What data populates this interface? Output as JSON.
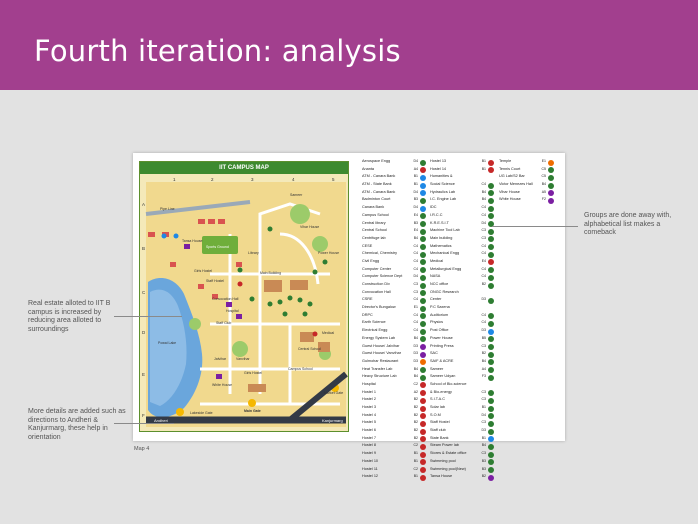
{
  "slide": {
    "title": "Fourth iteration: analysis",
    "accent": "#a23f8e"
  },
  "map": {
    "title": "IIT CAMPUS MAP",
    "col_labels": [
      "1",
      "2",
      "3",
      "4",
      "5"
    ],
    "row_labels": [
      "A",
      "B",
      "C",
      "D",
      "E",
      "F"
    ],
    "place_labels": [
      "Pipe Line",
      "Tansa House",
      "Sports Ground",
      "Library",
      "Sameer",
      "Vihar House",
      "Power House",
      "Girls Hostel",
      "Staff Hostel",
      "Convocation Hall",
      "Hospital",
      "Main Building",
      "Staff Club",
      "Powai Lake",
      "Jalvihar",
      "Vanvihar",
      "Girls Hostel",
      "Central School",
      "Campus School",
      "Medical",
      "White House",
      "Main Gate",
      "Market Gate",
      "Lakeside Gate",
      "Andheri",
      "Kanjurmarg"
    ]
  },
  "caption": "Map 4",
  "lists": {
    "col1": [
      {
        "name": "Aerospace Engg",
        "code": "D4",
        "color": "#2e7d32"
      },
      {
        "name": "Ananta",
        "code": "A4",
        "color": "#c62828"
      },
      {
        "name": "ATM - Canara Bank",
        "code": "B1",
        "color": "#1e88e5"
      },
      {
        "name": "ATM - State Bank",
        "code": "B1",
        "color": "#1e88e5"
      },
      {
        "name": "ATM - Canara Bank",
        "code": "D4",
        "color": "#1e88e5"
      },
      {
        "name": "Badminton Court",
        "code": "B3",
        "color": "#2e7d32"
      },
      {
        "name": "Canara Bank",
        "code": "D4",
        "color": "#1e88e5"
      },
      {
        "name": "Campus School",
        "code": "E4",
        "color": "#2e7d32"
      },
      {
        "name": "Central library",
        "code": "B3",
        "color": "#2e7d32"
      },
      {
        "name": "Central School",
        "code": "E4",
        "color": "#2e7d32"
      },
      {
        "name": "Centrifuge lab",
        "code": "B4",
        "color": "#2e7d32"
      },
      {
        "name": "CESE",
        "code": "C4",
        "color": "#2e7d32"
      },
      {
        "name": "Chemical, Chemistry",
        "code": "C4",
        "color": "#2e7d32"
      },
      {
        "name": "Civil Engg",
        "code": "C4",
        "color": "#2e7d32"
      },
      {
        "name": "Computer Center",
        "code": "C4",
        "color": "#2e7d32"
      },
      {
        "name": "Computer Science Dept",
        "code": "D4",
        "color": "#2e7d32"
      },
      {
        "name": "Construction Div",
        "code": "C3",
        "color": "#2e7d32"
      },
      {
        "name": "Convocation Hall",
        "code": "C3",
        "color": "#2e7d32"
      },
      {
        "name": "CSRE",
        "code": "C4",
        "color": "#2e7d32"
      },
      {
        "name": "Director's Bungalow",
        "code": "E1",
        "color": "#2e7d32"
      },
      {
        "name": "DRPC",
        "code": "C4",
        "color": "#2e7d32"
      },
      {
        "name": "Earth Science",
        "code": "C4",
        "color": "#2e7d32"
      },
      {
        "name": "Electrical Engg",
        "code": "C4",
        "color": "#2e7d32"
      },
      {
        "name": "Energy System Lab",
        "code": "B4",
        "color": "#2e7d32"
      },
      {
        "name": "Guest House/ Jalvihar",
        "code": "D3",
        "color": "#7b1fa2"
      },
      {
        "name": "Guest House/ Vanvihar",
        "code": "D3",
        "color": "#7b1fa2"
      },
      {
        "name": "Gulmohar Restaurant",
        "code": "D3",
        "color": "#ef6c00"
      },
      {
        "name": "Heat Transfer Lab",
        "code": "B4",
        "color": "#2e7d32"
      },
      {
        "name": "Heavy Structure Lab",
        "code": "B4",
        "color": "#2e7d32"
      },
      {
        "name": "Hospital",
        "code": "C2",
        "color": "#c62828"
      },
      {
        "name": "Hostel 1",
        "code": "A2",
        "color": "#c62828"
      },
      {
        "name": "Hostel 2",
        "code": "B2",
        "color": "#c62828"
      },
      {
        "name": "Hostel 3",
        "code": "B2",
        "color": "#c62828"
      },
      {
        "name": "Hostel 4",
        "code": "B2",
        "color": "#c62828"
      },
      {
        "name": "Hostel 5",
        "code": "B2",
        "color": "#c62828"
      },
      {
        "name": "Hostel 6",
        "code": "B2",
        "color": "#c62828"
      },
      {
        "name": "Hostel 7",
        "code": "B2",
        "color": "#c62828"
      },
      {
        "name": "Hostel 8",
        "code": "C2",
        "color": "#c62828"
      },
      {
        "name": "Hostel 9",
        "code": "B1",
        "color": "#c62828"
      },
      {
        "name": "Hostel 10",
        "code": "B1",
        "color": "#c62828"
      },
      {
        "name": "Hostel 11",
        "code": "C2",
        "color": "#c62828"
      },
      {
        "name": "Hostel 12",
        "code": "B1",
        "color": "#c62828"
      }
    ],
    "col2": [
      {
        "name": "Hostel 13",
        "code": "B1",
        "color": "#c62828"
      },
      {
        "name": "Hostel 14",
        "code": "B1",
        "color": "#c62828"
      },
      {
        "name": "Humanities &",
        "code": "",
        "color": ""
      },
      {
        "name": "Social Science",
        "code": "C4",
        "color": "#2e7d32"
      },
      {
        "name": "Hydraulics Lab",
        "code": "B4",
        "color": "#2e7d32"
      },
      {
        "name": "I.C. Engine Lab",
        "code": "B4",
        "color": "#2e7d32"
      },
      {
        "name": "IDC",
        "code": "C4",
        "color": "#2e7d32"
      },
      {
        "name": "I.R.C.C",
        "code": "C4",
        "color": "#2e7d32"
      },
      {
        "name": "K.R.E.S.I.T",
        "code": "D4",
        "color": "#2e7d32"
      },
      {
        "name": "Machine Tool Lab",
        "code": "C3",
        "color": "#2e7d32"
      },
      {
        "name": "Main building",
        "code": "C3",
        "color": "#2e7d32"
      },
      {
        "name": "Mathematics",
        "code": "C4",
        "color": "#2e7d32"
      },
      {
        "name": "Mechanical Engg",
        "code": "C4",
        "color": "#2e7d32"
      },
      {
        "name": "Medical",
        "code": "E4",
        "color": "#c62828"
      },
      {
        "name": "Metallurgical Engg",
        "code": "C4",
        "color": "#2e7d32"
      },
      {
        "name": "NASA",
        "code": "C4",
        "color": "#2e7d32"
      },
      {
        "name": "NCC office",
        "code": "B2",
        "color": "#2e7d32"
      },
      {
        "name": "ONGC Research",
        "code": "",
        "color": ""
      },
      {
        "name": "Center",
        "code": "D3",
        "color": "#2e7d32"
      },
      {
        "name": "P.C Saxena",
        "code": "",
        "color": ""
      },
      {
        "name": "Auditorium",
        "code": "C4",
        "color": "#2e7d32"
      },
      {
        "name": "Physics",
        "code": "C4",
        "color": "#2e7d32"
      },
      {
        "name": "Post Office",
        "code": "D3",
        "color": "#1e88e5"
      },
      {
        "name": "Power House",
        "code": "B5",
        "color": "#2e7d32"
      },
      {
        "name": "Printing Press",
        "code": "C3",
        "color": "#2e7d32"
      },
      {
        "name": "SAC",
        "code": "B2",
        "color": "#2e7d32"
      },
      {
        "name": "SAIF & ACRE",
        "code": "B4",
        "color": "#2e7d32"
      },
      {
        "name": "Sameer",
        "code": "A4",
        "color": "#2e7d32"
      },
      {
        "name": "Sameer Udyan",
        "code": "F3",
        "color": "#2e7d32"
      },
      {
        "name": "School of Bio-science",
        "code": "",
        "color": ""
      },
      {
        "name": "& Bio-energy",
        "code": "C3",
        "color": "#2e7d32"
      },
      {
        "name": "S.I.T.A.C",
        "code": "C3",
        "color": "#2e7d32"
      },
      {
        "name": "Solar lab",
        "code": "B1",
        "color": "#2e7d32"
      },
      {
        "name": "S.O.M",
        "code": "D4",
        "color": "#2e7d32"
      },
      {
        "name": "Staff Hostel",
        "code": "C3",
        "color": "#2e7d32"
      },
      {
        "name": "Staff club",
        "code": "D3",
        "color": "#2e7d32"
      },
      {
        "name": "State Bank",
        "code": "B1",
        "color": "#1e88e5"
      },
      {
        "name": "Steam Power lab",
        "code": "B4",
        "color": "#2e7d32"
      },
      {
        "name": "Stores & Estate office",
        "code": "C3",
        "color": "#2e7d32"
      },
      {
        "name": "Swimming pool",
        "code": "B3",
        "color": "#2e7d32"
      },
      {
        "name": "Swimming pool(New)",
        "code": "B3",
        "color": "#2e7d32"
      },
      {
        "name": "Tansa House",
        "code": "B2",
        "color": "#7b1fa2"
      }
    ],
    "col3": [
      {
        "name": "Temple",
        "code": "E1",
        "color": "#ef6c00"
      },
      {
        "name": "Tennis Court",
        "code": "C5",
        "color": "#2e7d32"
      },
      {
        "name": "UG Lab/S2 Bar",
        "code": "C5",
        "color": "#2e7d32"
      },
      {
        "name": "Victor Menezes Hall",
        "code": "B4",
        "color": "#2e7d32"
      },
      {
        "name": "Vihar House",
        "code": "A5",
        "color": "#7b1fa2"
      },
      {
        "name": "White House",
        "code": "F2",
        "color": "#7b1fa2"
      }
    ]
  },
  "annotations": {
    "right": "Groups are done away with, alphabetical list makes a comeback",
    "left1": "Real estate alloted to IIT B campus is increased by reducing area alloted to surroundings",
    "left2": "More details are added such as directions to Andheri & Kanjurmarg, these help in orientation"
  }
}
